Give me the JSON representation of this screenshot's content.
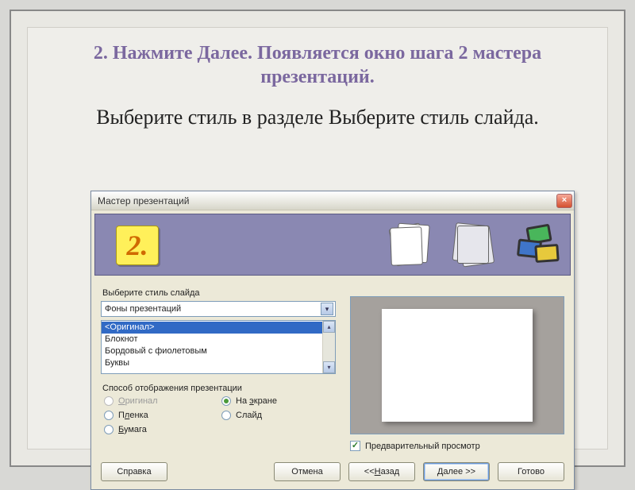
{
  "slide": {
    "title": "2. Нажмите Далее. Появляется окно шага 2 мастера презентаций.",
    "subtitle": "Выберите стиль в разделе Выберите стиль слайда."
  },
  "dialog": {
    "title": "Мастер презентаций",
    "close": "×",
    "step_number": "2.",
    "section_style_label": "Выберите стиль слайда",
    "combo_value": "Фоны презентаций",
    "combo_arrow": "▾",
    "list": {
      "items": [
        "<Оригинал>",
        "Блокнот",
        "Бордовый с фиолетовым",
        "Буквы"
      ],
      "selected_index": 0,
      "scroll_up": "▴",
      "scroll_down": "▾"
    },
    "section_output_label": "Способ отображения презентации",
    "radios": {
      "original": "Оригинал",
      "screen": "На экране",
      "film": "Пленка",
      "slide": "Слайд",
      "paper": "Бумага",
      "original_ul": "О",
      "screen_ul": "э",
      "film_ul": "л",
      "slide_ul": "д",
      "paper_ul": "Б"
    },
    "preview_label": "Предварительный просмотр",
    "buttons": {
      "help": "Справка",
      "cancel": "Отмена",
      "back_pre": "<< ",
      "back_ul": "Н",
      "back_post": "азад",
      "next_ul": "Д",
      "next_post": "алее >>",
      "finish": "Готово"
    }
  },
  "credit": ""
}
